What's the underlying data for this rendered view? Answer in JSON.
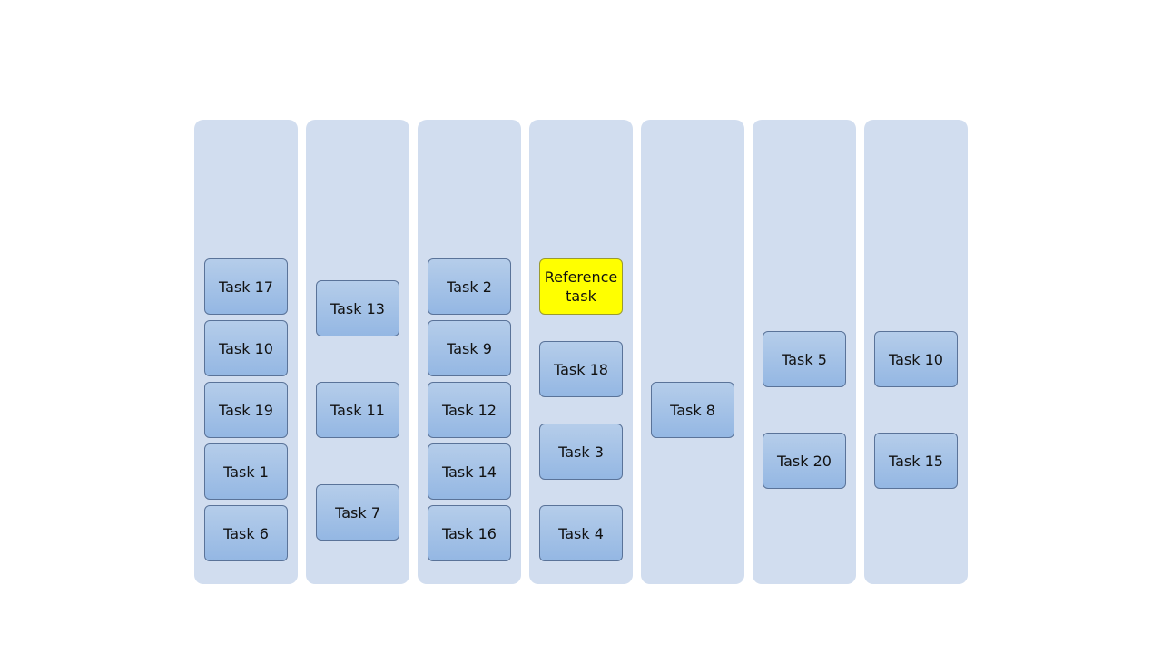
{
  "columns": [
    {
      "tasks": [
        "Task 17",
        "Task 10",
        "Task 19",
        "Task 1",
        "Task 6"
      ]
    },
    {
      "tasks": [
        "Task 13",
        "Task 11",
        "Task 7"
      ]
    },
    {
      "tasks": [
        "Task 2",
        "Task 9",
        "Task 12",
        "Task 14",
        "Task 16"
      ]
    },
    {
      "tasks": [
        "Reference task",
        "Task 18",
        "Task 3",
        "Task 4"
      ]
    },
    {
      "tasks": [
        "Task 8"
      ]
    },
    {
      "tasks": [
        "Task 5",
        "Task 20"
      ]
    },
    {
      "tasks": [
        "Task 10",
        "Task 15"
      ]
    }
  ],
  "colors": {
    "column": "#d1ddef",
    "task": "#a6c4e8",
    "reference": "#ffff00"
  }
}
